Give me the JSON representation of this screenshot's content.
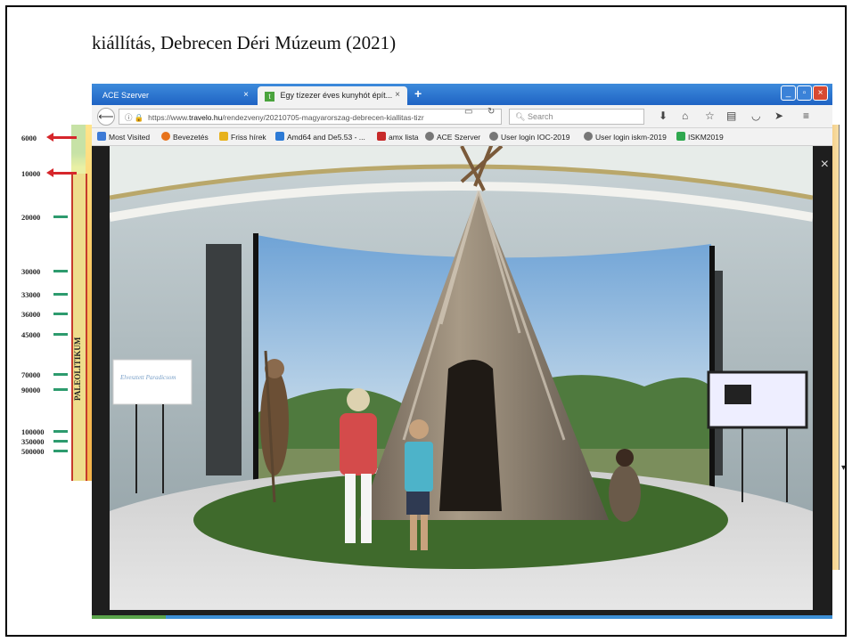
{
  "slide": {
    "title": "kiállítás, Debrecen Déri Múzeum (2021)"
  },
  "timeline": {
    "labels": [
      "6000",
      "10000",
      "20000",
      "30000",
      "33000",
      "36000",
      "45000",
      "70000",
      "90000",
      "100000",
      "350000",
      "500000"
    ],
    "period_label": "PALEOLITIKUM"
  },
  "browser": {
    "tabs": [
      {
        "title": "ACE Szerver",
        "close": "×"
      },
      {
        "title": "Egy tízezer éves kunyhót épít...",
        "close": "×",
        "favicon": "t"
      }
    ],
    "new_tab": "+",
    "window_controls": [
      "_",
      "▫",
      "×"
    ],
    "url": {
      "prefix": "https://www.",
      "host": "travelo.hu",
      "path": "/rendezveny/20210705-magyarorszag-debrecen-kiallitas-tizr"
    },
    "search_placeholder": "Search",
    "bookmarks": [
      {
        "label": "Most Visited",
        "color": "#3d7bd6"
      },
      {
        "label": "Bevezetés",
        "color": "#e7731c"
      },
      {
        "label": "Friss hírek",
        "color": "#e7b21c"
      },
      {
        "label": "Amd64 and De5.53 - ...",
        "color": "#2d7bd6"
      },
      {
        "label": "amx lista",
        "color": "#c72a2a"
      },
      {
        "label": "ACE Szerver",
        "color": "#777777"
      },
      {
        "label": "User login IOC-2019",
        "color": "#777777"
      },
      {
        "label": "User login iskm-2019",
        "color": "#777777"
      },
      {
        "label": "ISKM2019",
        "color": "#2fa84f"
      }
    ],
    "viewer_close": "×"
  },
  "photo": {
    "sign_left": "Elvesztett Paradicsom"
  }
}
